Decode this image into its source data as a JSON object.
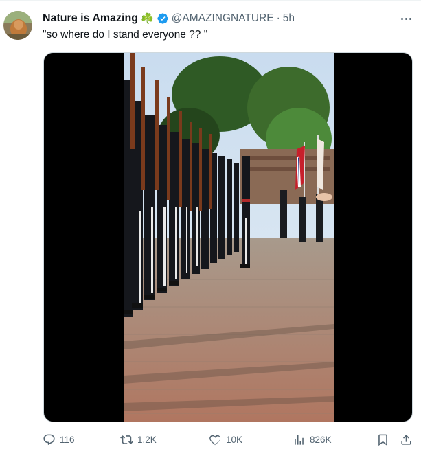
{
  "author": {
    "display_name": "Nature is Amazing",
    "name_emoji": "☘️",
    "handle": "@AMAZINGNATURE",
    "separator": "·",
    "timestamp": "5h",
    "verified": true
  },
  "tweet": {
    "text": "\"so where do I stand everyone ?? \""
  },
  "actions": {
    "replies": "116",
    "reposts": "1.2K",
    "likes": "10K",
    "views": "826K"
  },
  "colors": {
    "text_primary": "#0f1419",
    "text_secondary": "#536471",
    "verified_blue": "#1d9bf0",
    "border": "#cfd9de"
  },
  "icons": [
    "more-icon",
    "verified-badge-icon",
    "reply-icon",
    "repost-icon",
    "like-icon",
    "views-icon",
    "bookmark-icon",
    "share-icon"
  ]
}
